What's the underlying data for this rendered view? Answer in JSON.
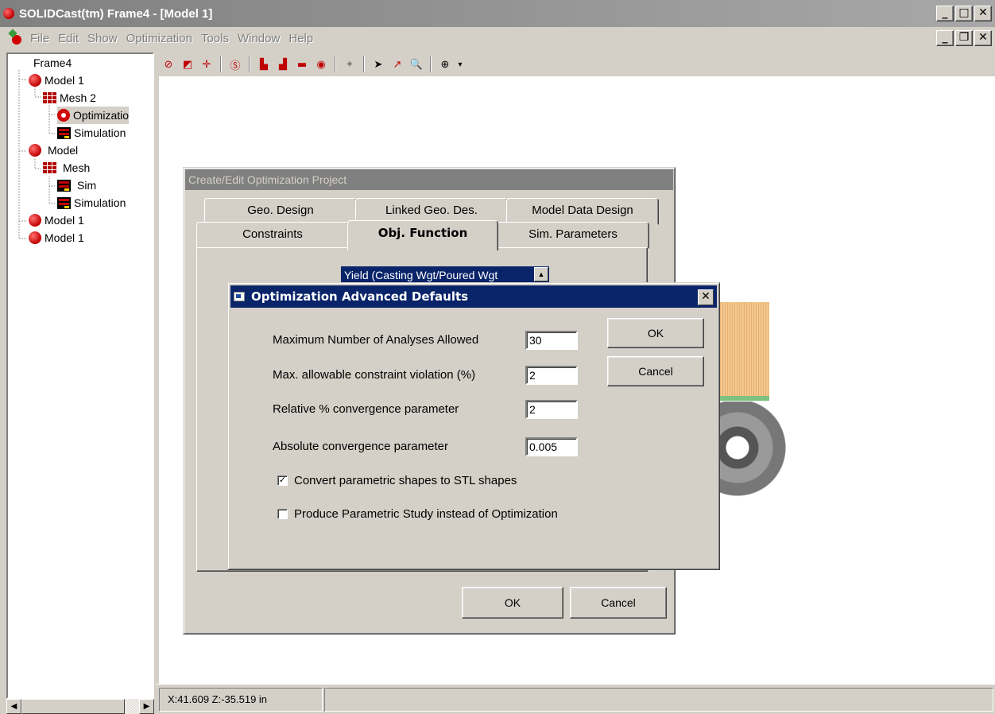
{
  "window": {
    "title": "SOLIDCast(tm) Frame4 - [Model 1]"
  },
  "menu": {
    "items": [
      "File",
      "Edit",
      "Show",
      "Optimization",
      "Tools",
      "Window",
      "Help"
    ]
  },
  "tree": {
    "items": [
      {
        "label": "Frame4",
        "icon": ""
      },
      {
        "label": "Model 1",
        "icon": "model-ball-icon"
      },
      {
        "label": "Mesh 2",
        "icon": "mesh-icon"
      },
      {
        "label": "Optimizatio",
        "icon": "optimization-icon"
      },
      {
        "label": "Simulation",
        "icon": "simulation-icon"
      },
      {
        "label": "Model",
        "icon": "model-ball-icon"
      },
      {
        "label": "Mesh",
        "icon": "mesh-icon"
      },
      {
        "label": "Sim",
        "icon": "simulation-icon"
      },
      {
        "label": "Simulation",
        "icon": "simulation-icon"
      },
      {
        "label": "Model 1",
        "icon": "model-ball-icon"
      },
      {
        "label": "Model 1",
        "icon": "model-ball-icon"
      }
    ]
  },
  "status": {
    "coords": "X:41.609 Z:-35.519 in"
  },
  "project_dialog": {
    "title": "Create/Edit Optimization Project",
    "tabs_row1": [
      "Geo. Design",
      "Linked Geo. Des.",
      "Model Data Design"
    ],
    "tabs_row2": [
      "Constraints",
      "Obj. Function",
      "Sim. Parameters"
    ],
    "active_tab": "Obj. Function",
    "objective_value": "Yield (Casting Wgt/Poured Wgt",
    "ok_label": "OK",
    "cancel_label": "Cancel"
  },
  "advanced_dialog": {
    "title": "Optimization Advanced Defaults",
    "fields": [
      {
        "label": "Maximum Number of Analyses Allowed",
        "value": "30"
      },
      {
        "label": "Max. allowable constraint violation (%)",
        "value": "2"
      },
      {
        "label": "Relative % convergence parameter",
        "value": "2"
      },
      {
        "label": "Absolute convergence parameter",
        "value": "0.005"
      }
    ],
    "checkboxes": [
      {
        "label": "Convert parametric shapes to STL shapes",
        "checked": true,
        "mark": "✓"
      },
      {
        "label": "Produce Parametric Study instead of Optimization",
        "checked": false,
        "mark": ""
      }
    ],
    "ok_label": "OK",
    "cancel_label": "Cancel"
  }
}
